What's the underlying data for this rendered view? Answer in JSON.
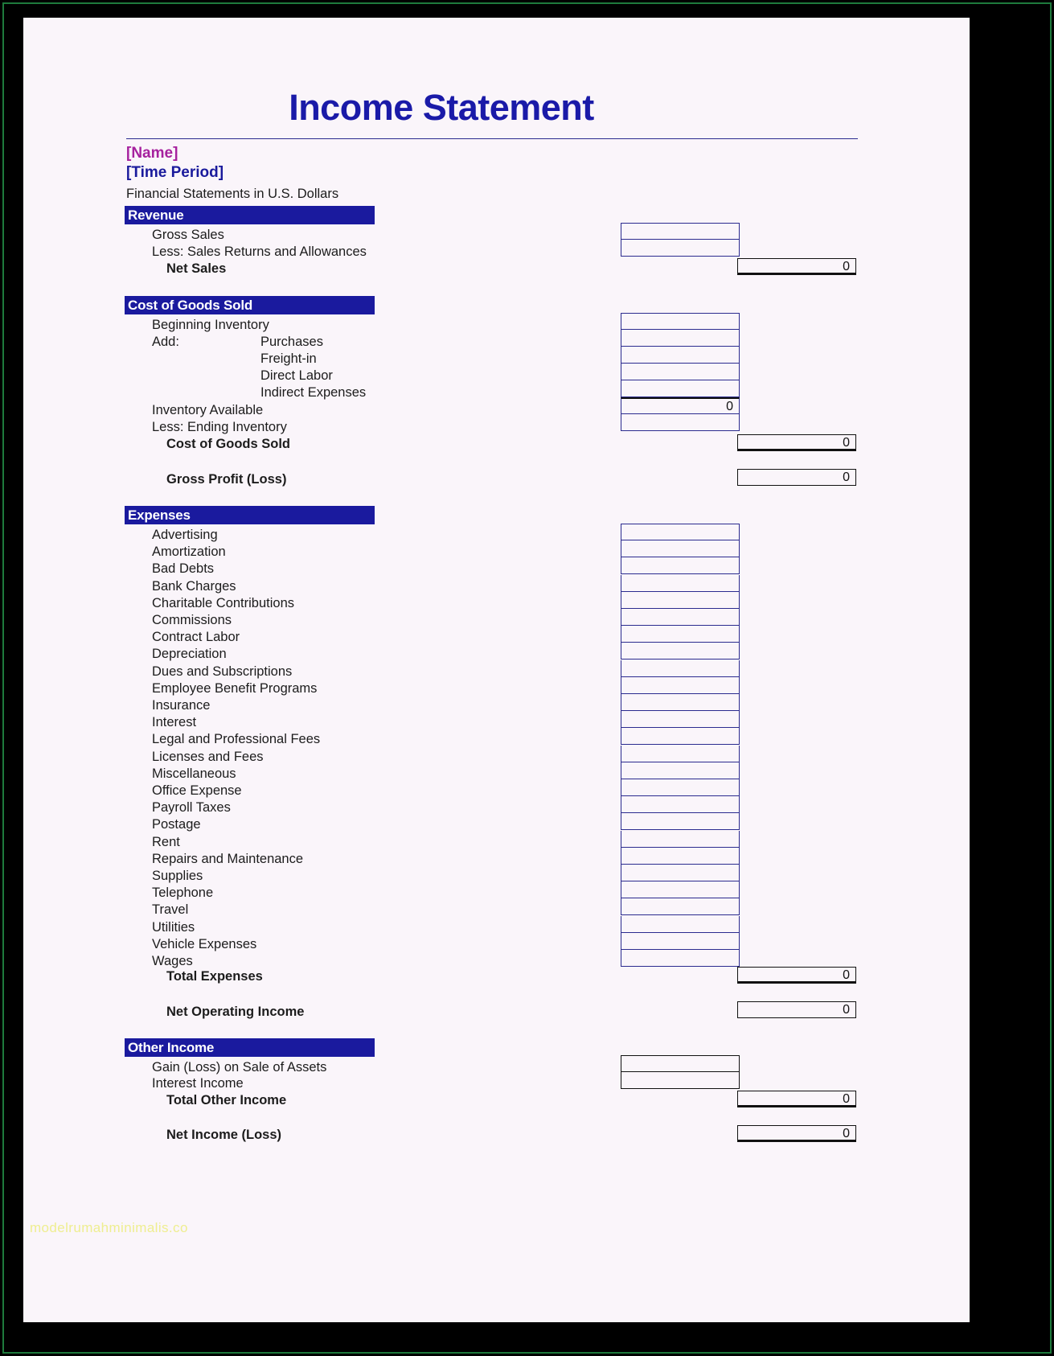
{
  "document": {
    "title": "Income Statement",
    "name_placeholder": "[Name]",
    "time_period_placeholder": "[Time Period]",
    "currency_note": "Financial Statements in U.S. Dollars",
    "watermark": "modelrumahminimalis.co"
  },
  "colors": {
    "section_bar": "#1a1a9e",
    "title": "#1a1aa8",
    "name": "#a6219e",
    "period": "#1a1a9c",
    "page": "#faf5fa",
    "border": "#000000",
    "watermark": "#eeee90"
  },
  "sections": {
    "revenue": {
      "heading": "Revenue",
      "rows": [
        {
          "label": "Gross Sales",
          "value": ""
        },
        {
          "label": "Less: Sales Returns and Allowances",
          "value": ""
        },
        {
          "label": "Net Sales",
          "value": "0"
        }
      ]
    },
    "cogs": {
      "heading": "Cost of Goods Sold",
      "rows": [
        {
          "label": "Beginning Inventory",
          "value": ""
        },
        {
          "label": "Add:",
          "sublabel": "Purchases",
          "value": ""
        },
        {
          "label": "",
          "sublabel": "Freight-in",
          "value": ""
        },
        {
          "label": "",
          "sublabel": "Direct Labor",
          "value": ""
        },
        {
          "label": "",
          "sublabel": "Indirect Expenses",
          "value": ""
        },
        {
          "label": "Inventory Available",
          "value": "0"
        },
        {
          "label": "Less: Ending Inventory",
          "value": ""
        },
        {
          "label": "Cost of Goods Sold",
          "value": "0"
        }
      ],
      "gross_profit": {
        "label": "Gross Profit (Loss)",
        "value": "0"
      }
    },
    "expenses": {
      "heading": "Expenses",
      "items": [
        "Advertising",
        "Amortization",
        "Bad Debts",
        "Bank Charges",
        "Charitable Contributions",
        "Commissions",
        "Contract Labor",
        "Depreciation",
        "Dues and Subscriptions",
        "Employee Benefit Programs",
        "Insurance",
        "Interest",
        "Legal and Professional Fees",
        "Licenses and Fees",
        "Miscellaneous",
        "Office Expense",
        "Payroll Taxes",
        "Postage",
        "Rent",
        "Repairs and Maintenance",
        "Supplies",
        "Telephone",
        "Travel",
        "Utilities",
        "Vehicle Expenses",
        "Wages"
      ],
      "total": {
        "label": "Total Expenses",
        "value": "0"
      },
      "net_operating_income": {
        "label": "Net Operating Income",
        "value": "0"
      }
    },
    "other_income": {
      "heading": "Other Income",
      "rows": [
        {
          "label": "Gain (Loss) on Sale of Assets",
          "value": ""
        },
        {
          "label": "Interest Income",
          "value": ""
        }
      ],
      "total": {
        "label": "Total Other Income",
        "value": "0"
      },
      "net_income": {
        "label": "Net Income (Loss)",
        "value": "0"
      }
    }
  }
}
